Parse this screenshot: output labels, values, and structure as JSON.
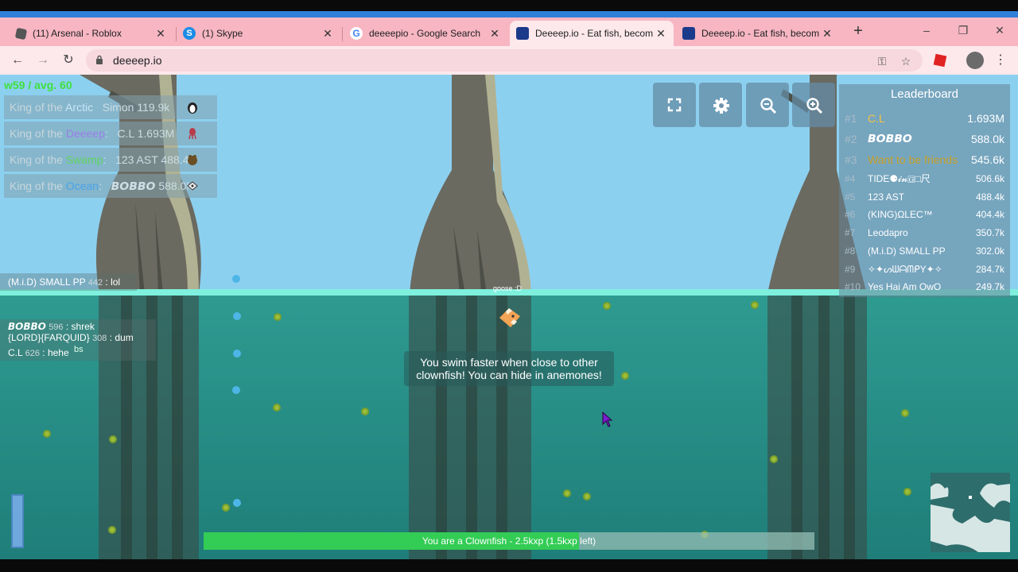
{
  "browser": {
    "tabs": [
      {
        "title": "(11) Arsenal - Roblox",
        "icon": "roblox-icon",
        "active": false
      },
      {
        "title": "(1) Skype",
        "icon": "skype-icon",
        "active": false
      },
      {
        "title": "deeeepio - Google Search",
        "icon": "google-icon",
        "active": false
      },
      {
        "title": "Deeeep.io - Eat fish, becom",
        "icon": "deeeep-icon",
        "active": true
      },
      {
        "title": "Deeeep.io - Eat fish, becom",
        "icon": "deeeep-icon",
        "active": false
      }
    ],
    "new_tab": "+",
    "url": "deeeep.io",
    "window_controls": {
      "minimize": "–",
      "restore": "❐",
      "close": "✕"
    }
  },
  "game": {
    "stats": "w59 / avg. 60",
    "kings": [
      {
        "prefix": "King of the ",
        "biome": "Arctic",
        "biome_color": "#c8e6f5",
        "player": "Simon",
        "score": "119.9k",
        "icon": "penguin-icon"
      },
      {
        "prefix": "King of the ",
        "biome": "Deeeep",
        "biome_color": "#9b7fe8",
        "player": "C.L",
        "score": "1.693M",
        "icon": "squid-icon"
      },
      {
        "prefix": "King of the ",
        "biome": "Swamp",
        "biome_color": "#5fd45f",
        "player": "123 AST",
        "score": "488.4k",
        "icon": "frog-icon"
      },
      {
        "prefix": "King of the ",
        "biome": "Ocean",
        "biome_color": "#4aa3e8",
        "player": "𝘽𝙊𝘽𝘽𝙊",
        "score": "588.0k",
        "icon": "shark-icon"
      }
    ],
    "tools": [
      {
        "name": "fullscreen-button",
        "icon": "fullscreen-icon"
      },
      {
        "name": "settings-button",
        "icon": "gear-icon"
      },
      {
        "name": "zoom-out-button",
        "icon": "zoom-out-icon"
      },
      {
        "name": "zoom-in-button",
        "icon": "zoom-in-icon"
      }
    ],
    "leaderboard": {
      "title": "Leaderboard",
      "rows": [
        {
          "rank": "#1",
          "name": "C.L",
          "score": "1.693M",
          "color": "#f5c542"
        },
        {
          "rank": "#2",
          "name": "𝘽𝙊𝘽𝘽𝙊",
          "score": "588.0k",
          "color": "#ffffff"
        },
        {
          "rank": "#3",
          "name": "Want to be friends",
          "score": "545.6k",
          "color": "#c9a227"
        },
        {
          "rank": "#4",
          "name": "TIDE⚈𝓲𝓷🄶□尺",
          "score": "506.6k",
          "color": "#ffffff"
        },
        {
          "rank": "#5",
          "name": "123 AST",
          "score": "488.4k",
          "color": "#ffffff"
        },
        {
          "rank": "#6",
          "name": "(KING)ΩLEC™",
          "score": "404.4k",
          "color": "#ffffff"
        },
        {
          "rank": "#7",
          "name": "Leodapro",
          "score": "350.7k",
          "color": "#ffffff"
        },
        {
          "rank": "#8",
          "name": "(M.i.D) SMALL PP",
          "score": "302.0k",
          "color": "#ffffff"
        },
        {
          "rank": "#9",
          "name": "✧✦ᔕᗯᗩᗰᑭY✦✧",
          "score": "284.7k",
          "color": "#ffffff"
        },
        {
          "rank": "#10",
          "name": "Yes Hai Am OwO",
          "score": "249.7k",
          "color": "#ffffff"
        }
      ]
    },
    "chat": [
      {
        "name": "(M.i.D) SMALL PP",
        "level": "442",
        "msg": ": lol"
      },
      {
        "name": "𝘽𝙊𝘽𝘽𝙊",
        "level": "596",
        "msg": ": shrek"
      },
      {
        "name": "{LORD}{FARQUID}",
        "level": "308",
        "msg": ": dum"
      },
      {
        "name": "C.L",
        "level": "626",
        "msg": ": hehe"
      }
    ],
    "chat_fragment": "bs",
    "player_name": "goose :D",
    "tip": "You swim faster when close to other clownfish! You can hide in anemones!",
    "xp_text": "You are a Clownfish - 2.5kxp (1.5kxp left)",
    "xp_progress": 0.615
  }
}
